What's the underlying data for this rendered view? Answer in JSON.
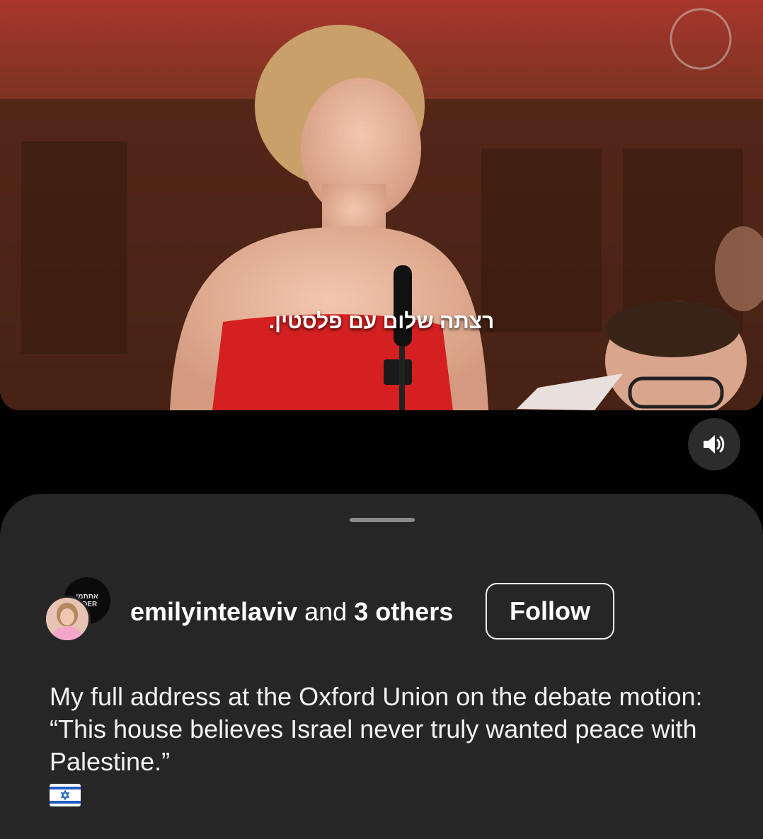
{
  "video": {
    "subtitle": "רצתה שלום עם פלסטין.",
    "sound_icon": "volume-on-icon"
  },
  "post": {
    "author": "emilyintelaviv",
    "collab_joiner": " and ",
    "collab_others": "3 others",
    "follow_label": "Follow",
    "caption": "My full address at the Oxford Union on the debate motion: “This house believes Israel never truly wanted peace with Palestine.”",
    "caption_emoji": "israel-flag-icon",
    "secondary_avatar_text": [
      "אתתמי",
      "UDER"
    ]
  },
  "colors": {
    "sheet_bg": "#262626",
    "page_bg": "#000000",
    "text": "#ffffff"
  }
}
